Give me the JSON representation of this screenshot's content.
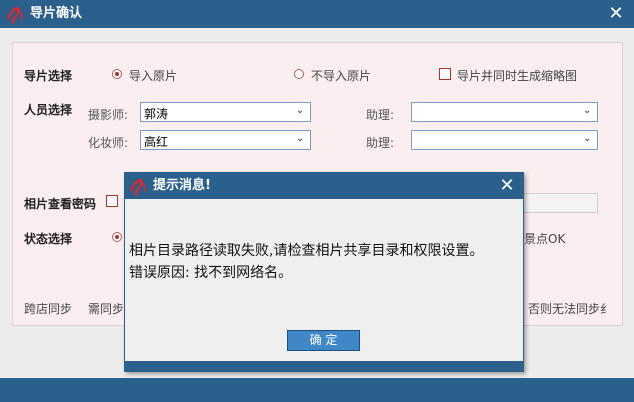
{
  "window": {
    "title": "导片确认",
    "close_glyph": "✕"
  },
  "import_select": {
    "label": "导片选择",
    "options": [
      {
        "label": "导入原片",
        "selected": true
      },
      {
        "label": "不导入原片",
        "selected": false
      }
    ],
    "thumbnail_checkbox": {
      "label": "导片并同时生成缩略图",
      "checked": false
    }
  },
  "staff_select": {
    "label": "人员选择",
    "photographer": {
      "label": "摄影师:",
      "value": "郭涛"
    },
    "makeup": {
      "label": "化妆师:",
      "value": "高红"
    },
    "assistant1": {
      "label": "助理:",
      "value": ""
    },
    "assistant2": {
      "label": "助理:",
      "value": ""
    }
  },
  "photo_password": {
    "label": "相片查看密码"
  },
  "status_select": {
    "label": "状态选择",
    "partial_option": "景点OK"
  },
  "cross_store": {
    "label": "跨店同步",
    "hint_left": "需同步",
    "hint_right": "否则无法同步纟"
  },
  "dialog": {
    "title": "提示消息!",
    "close_glyph": "✕",
    "message_line1": "相片目录路径读取失败,请检查相片共享目录和权限设置。",
    "message_line2": "错误原因: 找不到网络名。",
    "ok_label": "确 定"
  },
  "colors": {
    "titlebar": "#2b5f8c",
    "form_bg": "#fbeef1",
    "accent_red": "#b03030",
    "ok_button": "#3f87c6"
  }
}
